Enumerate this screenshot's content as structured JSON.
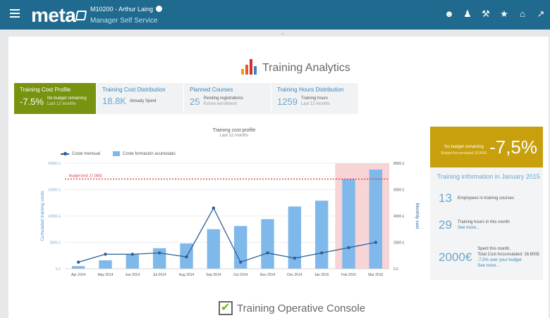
{
  "header": {
    "logo": "meta",
    "user": "M10200 - Arthur Laing",
    "role": "Manager Self Service",
    "icons": [
      "user-icon",
      "profile-icon",
      "tools-icon",
      "star-icon",
      "home-icon",
      "arrow-icon"
    ],
    "collapse": "⌄"
  },
  "page": {
    "title": "Training Analytics"
  },
  "tabs": [
    {
      "label": "Training Cost Profile",
      "value": "-7.5%",
      "desc": "No budget remaining",
      "sub": "Last 12 months"
    },
    {
      "label": "Training Cost Distribution",
      "value": "18.8K",
      "desc": "Already Spent",
      "sub": ""
    },
    {
      "label": "Planned Courses",
      "value": "25",
      "desc": "Pending registrations",
      "sub": "Future enrollment"
    },
    {
      "label": "Training Hours Distribution",
      "value": "1259",
      "desc": "Training hours",
      "sub": "Last 12 months"
    }
  ],
  "chart_data": {
    "type": "bar",
    "title": "Training cost profile",
    "subtitle": "Last 12 months",
    "categories": [
      "Apr 2014",
      "May 2014",
      "Jun 2014",
      "Jul 2014",
      "Aug 2014",
      "Sep 2014",
      "Oct 2014",
      "Nov 2014",
      "Dec 2014",
      "Jan 2015",
      "Feb 2015",
      "Mar 2015"
    ],
    "series": [
      {
        "name": "Coste formación acumulado",
        "type": "bar",
        "axis": "left",
        "values": [
          500,
          1600,
          2700,
          3900,
          4800,
          7500,
          8100,
          9400,
          11800,
          12900,
          17000,
          18800
        ],
        "color": "#7fb8ea"
      },
      {
        "name": "Coste mensual",
        "type": "line",
        "axis": "right",
        "values": [
          500,
          1100,
          1100,
          1200,
          900,
          4600,
          500,
          1200,
          800,
          1200,
          1600,
          2000
        ],
        "color": "#2d5f93"
      }
    ],
    "ylabel": "Cumulated training costs",
    "y2label": "Monthly cost",
    "ylim": [
      0,
      20000
    ],
    "y2lim": [
      0,
      8000
    ],
    "yticks": [
      "0 £",
      "5000 £",
      "10000 £",
      "15000 £",
      "20000 £"
    ],
    "y2ticks": [
      "0 £",
      "2000 £",
      "4000 £",
      "6000 £",
      "8000 £"
    ],
    "budget_limit": {
      "value": 17000,
      "label": "Budget limit: 17,000£",
      "color": "#e03030"
    },
    "highlight_categories": [
      "Feb 2015",
      "Mar 2015"
    ],
    "legend_position": "top-left",
    "grid": true
  },
  "side": {
    "head_label": "No budget remaining",
    "head_sub": "Budget Accumulated 18.800£",
    "head_value": "-7,5%",
    "title": "Training information in January 2015",
    "stats": [
      {
        "num": "13",
        "desc": "Employees in training courses",
        "link": ""
      },
      {
        "num": "29",
        "desc": "Training hours in this month",
        "link": "See more..."
      },
      {
        "num": "2000€",
        "desc": "Spent this month.",
        "desc2": "Total Cost Accumulated: 18.800£",
        "desc3": "-7,5% over your budget",
        "link": "See more..."
      }
    ]
  },
  "bottom": {
    "title": "Training Operative Console"
  }
}
